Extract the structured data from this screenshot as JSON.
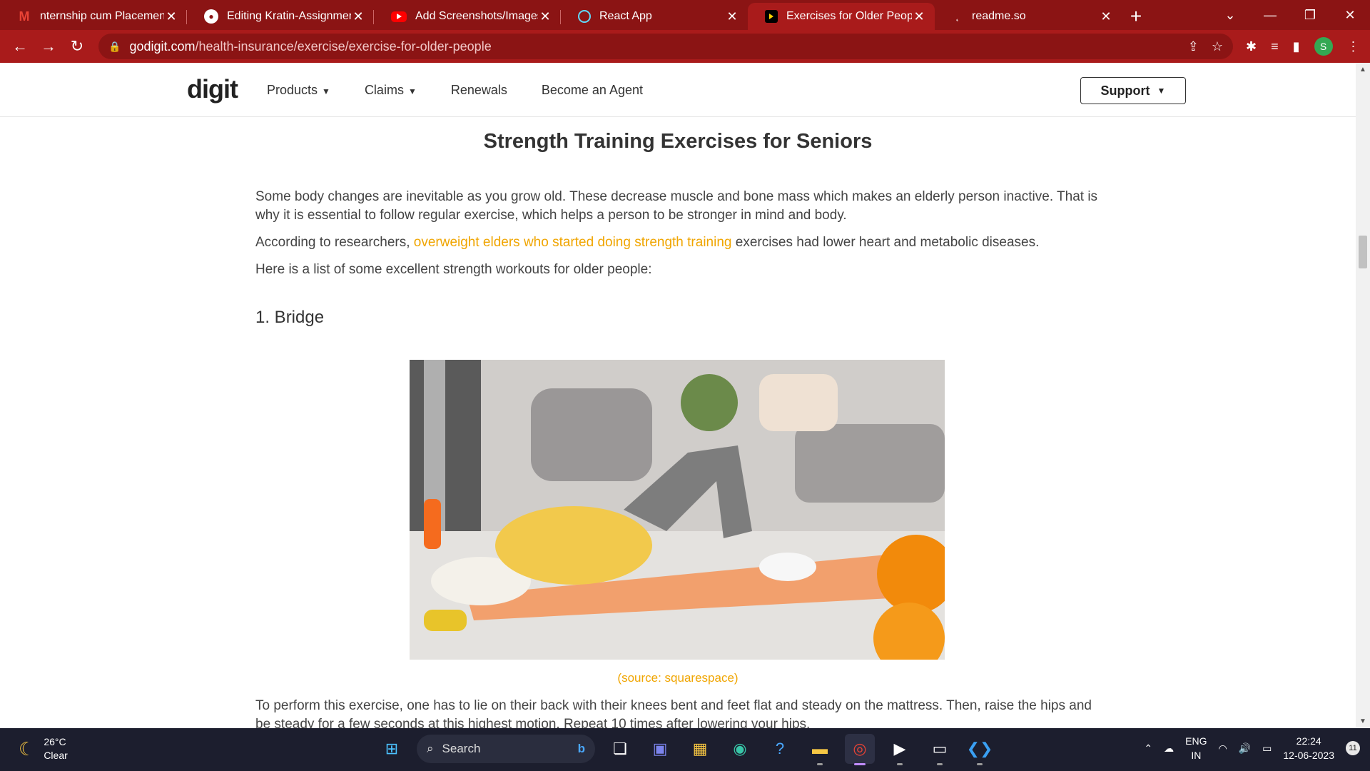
{
  "browser": {
    "tabs": [
      {
        "title": "nternship cum Placement -",
        "icon": "gmail-icon",
        "active": false
      },
      {
        "title": "Editing Kratin-Assignment-",
        "icon": "github-icon",
        "active": false
      },
      {
        "title": "Add Screenshots/Images in",
        "icon": "youtube-icon",
        "active": false
      },
      {
        "title": "React App",
        "icon": "react-icon",
        "active": false
      },
      {
        "title": "Exercises for Older People:",
        "icon": "digit-icon",
        "active": true
      },
      {
        "title": "readme.so",
        "icon": "readme-icon",
        "active": false
      }
    ],
    "url_host": "godigit.com",
    "url_path": "/health-insurance/exercise/exercise-for-older-people",
    "profile_initial": "S",
    "accent_color": "#a91b1b"
  },
  "site": {
    "logo": "digit",
    "nav": [
      "Products",
      "Claims",
      "Renewals",
      "Become an Agent"
    ],
    "support_label": "Support"
  },
  "article": {
    "heading": "Strength Training Exercises for Seniors",
    "para1": "Some body changes are inevitable as you grow old. These decrease muscle and bone mass which makes an elderly person inactive. That is why it is essential to follow regular exercise, which helps a person to be stronger in mind and body.",
    "para2_before": "According to researchers, ",
    "para2_link": "overweight elders who started doing strength training",
    "para2_after": " exercises had lower heart and metabolic diseases.",
    "para3": "Here is a list of some excellent strength workouts for older people:",
    "subheading": "1. Bridge",
    "caption": "(source: squarespace)",
    "para4": "To perform this exercise, one has to lie on their back with their knees bent and feet flat and steady on the mattress. Then, raise the hips and be steady for a few seconds at this highest motion. Repeat 10 times after lowering your hips."
  },
  "taskbar": {
    "temperature": "26°C",
    "weather": "Clear",
    "search_label": "Search",
    "lang_top": "ENG",
    "lang_bottom": "IN",
    "time": "22:24",
    "date": "12-06-2023",
    "notification_count": "11"
  }
}
